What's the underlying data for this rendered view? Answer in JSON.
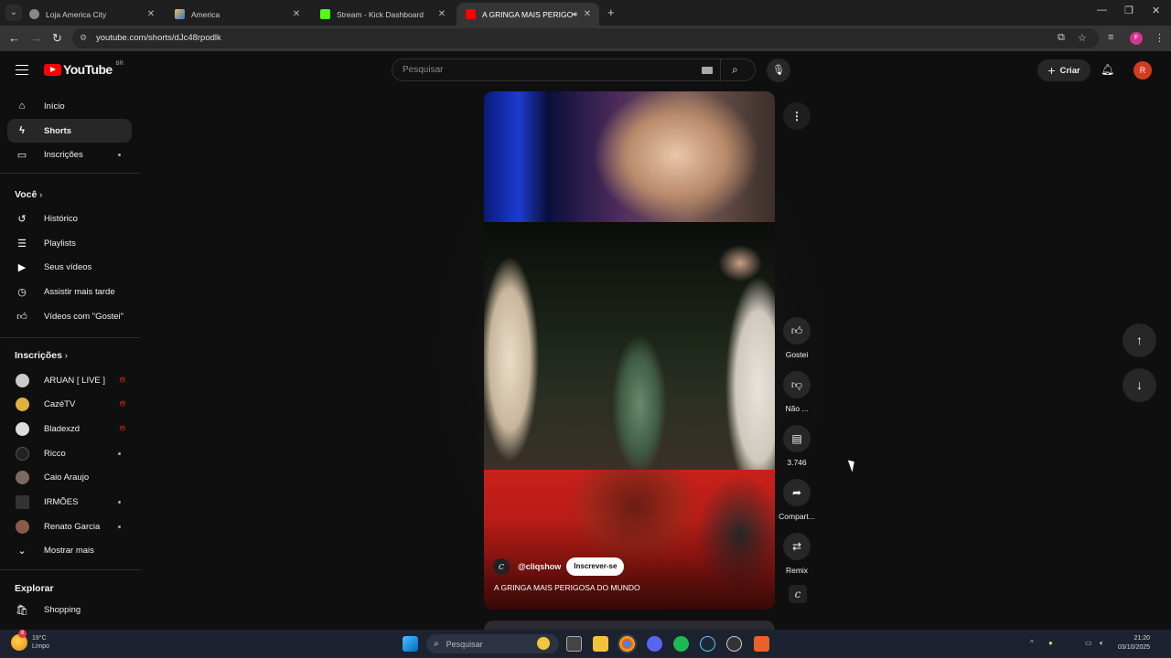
{
  "browser": {
    "tabs": [
      {
        "title": "Loja America City",
        "active": false
      },
      {
        "title": "America",
        "active": false
      },
      {
        "title": "Stream - Kick Dashboard",
        "active": false
      },
      {
        "title": "A GRINGA MAIS PERIGOSA",
        "active": true
      }
    ],
    "url": "youtube.com/shorts/dJc48rpodlk",
    "profile_initial": "F"
  },
  "header": {
    "logo_text": "YouTube",
    "region": "BR",
    "search_placeholder": "Pesquisar",
    "create_label": "Criar",
    "avatar_initial": "R"
  },
  "sidebar": {
    "main": [
      {
        "label": "Início",
        "icon": "home-icon"
      },
      {
        "label": "Shorts",
        "icon": "shorts-icon",
        "active": true
      },
      {
        "label": "Inscrições",
        "icon": "subscriptions-icon"
      }
    ],
    "you_title": "Você",
    "you": [
      {
        "label": "Histórico",
        "icon": "history-icon"
      },
      {
        "label": "Playlists",
        "icon": "playlists-icon"
      },
      {
        "label": "Seus vídeos",
        "icon": "your-videos-icon"
      },
      {
        "label": "Assistir mais tarde",
        "icon": "watch-later-icon"
      },
      {
        "label": "Vídeos com \"Gostei\"",
        "icon": "liked-icon"
      }
    ],
    "subs_title": "Inscrições",
    "subs": [
      {
        "label": "ARUAN [ LIVE ]",
        "status": "live"
      },
      {
        "label": "CazéTV",
        "status": "live"
      },
      {
        "label": "Bladexzd",
        "status": "live"
      },
      {
        "label": "Ricco",
        "status": "dot"
      },
      {
        "label": "Caio Araujo",
        "status": ""
      },
      {
        "label": "IRMÕES",
        "status": "dot"
      },
      {
        "label": "Renato Garcia",
        "status": "dot"
      }
    ],
    "show_more": "Mostrar mais",
    "explore_title": "Explorar",
    "explore": [
      {
        "label": "Shopping",
        "icon": "shopping-icon"
      }
    ]
  },
  "short": {
    "channel": "@cliqshow",
    "subscribe_label": "Inscrever-se",
    "title": "A GRINGA MAIS PERIGOSA DO MUNDO"
  },
  "actions": {
    "like": "Gostei",
    "dislike": "Não ...",
    "comments": "3.746",
    "share": "Compart...",
    "remix": "Remix"
  },
  "taskbar": {
    "weather_temp": "19°C",
    "weather_desc": "Limpo",
    "weather_badge": "8",
    "search_placeholder": "Pesquisar",
    "time": "21:20",
    "date": "03/10/2025"
  }
}
